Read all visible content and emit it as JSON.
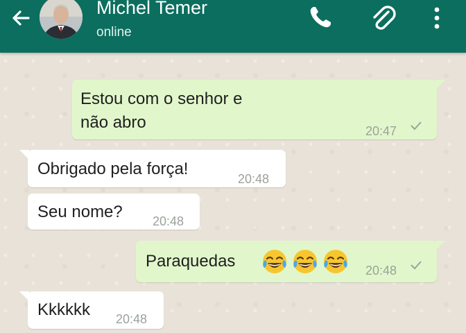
{
  "header": {
    "contact_name": "Michel Temer",
    "status": "online",
    "bg_color": "#0b6e5f"
  },
  "icons": {
    "back": "arrow-left",
    "call": "phone",
    "attach": "paperclip",
    "menu": "vertical-ellipsis",
    "avatar": "contact-photo"
  },
  "messages": [
    {
      "direction": "outgoing",
      "lines": [
        "Estou com o senhor e",
        "não abro"
      ],
      "time": "20:47",
      "status": "sent-check"
    },
    {
      "direction": "incoming",
      "text": "Obrigado pela força!",
      "time": "20:48"
    },
    {
      "direction": "incoming",
      "text": "Seu nome?",
      "time": "20:48"
    },
    {
      "direction": "outgoing",
      "text": "Paraquedas",
      "emojis": [
        "face-with-tears-of-joy",
        "face-with-tears-of-joy",
        "face-with-tears-of-joy"
      ],
      "time": "20:48",
      "status": "sent-check"
    },
    {
      "direction": "incoming",
      "text": "Kkkkkk",
      "time": "20:48"
    }
  ],
  "colors": {
    "outgoing_bubble": "#e1f7cb",
    "incoming_bubble": "#ffffff",
    "chat_background": "#e8e2d8",
    "timestamp": "#9aa39a"
  }
}
